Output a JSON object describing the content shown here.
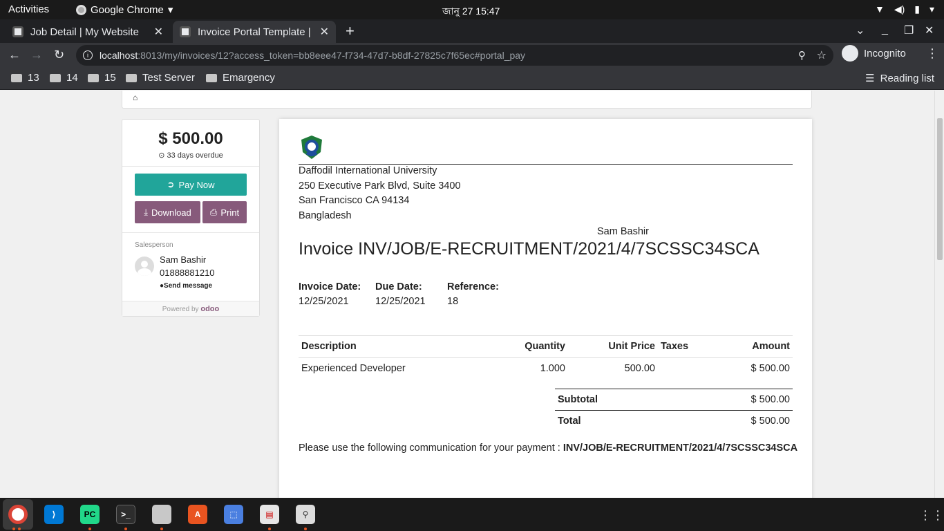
{
  "topbar": {
    "activities": "Activities",
    "app_name": "Google Chrome",
    "clock": "জানু 27  15:47"
  },
  "tabs": [
    {
      "label": "Job Detail | My Website",
      "active": false
    },
    {
      "label": "Invoice Portal Template | ",
      "active": true
    }
  ],
  "omnibox": {
    "host": "localhost",
    "path": ":8013/my/invoices/12?access_token=bb8eee47-f734-47d7-b8df-27825c7f65ec#portal_pay"
  },
  "incognito_label": "Incognito",
  "bookmarks": [
    "13",
    "14",
    "15",
    "Test Server",
    "Emargency"
  ],
  "reading_list": "Reading list",
  "sidebar": {
    "amount": "$ 500.00",
    "overdue": "33 days overdue",
    "pay_now": "Pay Now",
    "download": "Download",
    "print": "Print",
    "salesperson_label": "Salesperson",
    "salesperson_name": "Sam Bashir",
    "salesperson_phone": "01888881210",
    "send_message": "Send message",
    "powered_by": "Powered by",
    "odoo": "odoo"
  },
  "invoice": {
    "company": {
      "name": "Daffodil International University",
      "street": "250 Executive Park Blvd, Suite 3400",
      "city": "San Francisco CA 94134",
      "country": "Bangladesh"
    },
    "customer": "Sam Bashir",
    "title": "Invoice INV/JOB/E-RECRUITMENT/2021/4/7SCSSC34SCA",
    "meta": [
      {
        "label": "Invoice Date:",
        "value": "12/25/2021"
      },
      {
        "label": "Due Date:",
        "value": "12/25/2021"
      },
      {
        "label": "Reference:",
        "value": "18"
      }
    ],
    "columns": [
      "Description",
      "Quantity",
      "Unit Price",
      "Taxes",
      "Amount"
    ],
    "lines": [
      {
        "description": "Experienced Developer",
        "quantity": "1.000",
        "unit_price": "500.00",
        "taxes": "",
        "amount": "$ 500.00"
      }
    ],
    "subtotal_label": "Subtotal",
    "subtotal": "$ 500.00",
    "total_label": "Total",
    "total": "$ 500.00",
    "communication_text": "Please use the following communication for your payment : ",
    "communication_ref": "INV/JOB/E-RECRUITMENT/2021/4/7SCSSC34SCA"
  },
  "colors": {
    "pay_button": "#21a59a",
    "secondary_button": "#875a7b",
    "chrome_dark": "#202124",
    "toolbar": "#35363a"
  }
}
